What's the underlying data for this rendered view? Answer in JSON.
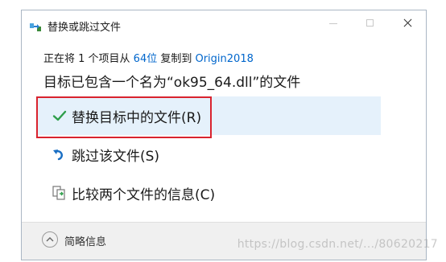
{
  "window": {
    "title": "替换或跳过文件",
    "icons": {
      "app": "file-transfer-icon",
      "minimize": "minimize-icon",
      "maximize": "maximize-icon",
      "close": "close-icon"
    }
  },
  "copy_status": {
    "prefix": "正在将 1 个项目从 ",
    "source": "64位",
    "middle": " 复制到 ",
    "destination": "Origin2018"
  },
  "message": "目标已包含一个名为“ok95_64.dll”的文件",
  "options": {
    "replace": {
      "label": "替换目标中的文件(R)",
      "icon": "checkmark-icon",
      "color": "#2e9e4a"
    },
    "skip": {
      "label": "跳过该文件(S)",
      "icon": "skip-arrow-icon",
      "color": "#1a6fc4"
    },
    "compare": {
      "label": "比较两个文件的信息(C)",
      "icon": "compare-files-icon"
    }
  },
  "footer": {
    "details_label": "简略信息",
    "toggle_icon": "chevron-up-icon"
  },
  "watermark": "https://blog.csdn.net/.../80620217",
  "colors": {
    "highlight_border": "#d9232e",
    "selected_bg": "#e5f1fb",
    "link": "#0066cc"
  }
}
